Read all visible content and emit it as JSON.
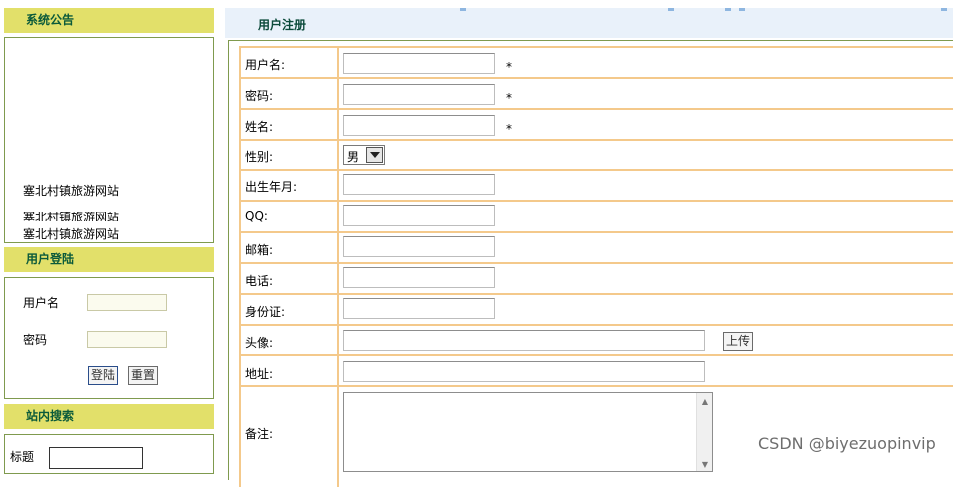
{
  "sidebar": {
    "notice": {
      "title": "系统公告",
      "items": [
        "塞北村镇旅游网站",
        "塞北村镇旅游网站",
        "塞北村镇旅游网站"
      ]
    },
    "login": {
      "title": "用户登陆",
      "username_label": "用户名",
      "password_label": "密码",
      "login_button": "登陆",
      "reset_button": "重置"
    },
    "search": {
      "title": "站内搜索",
      "title_label": "标题"
    }
  },
  "register": {
    "title": "用户注册",
    "required_mark": "*",
    "fields": {
      "username": "用户名:",
      "password": "密码:",
      "name": "姓名:",
      "gender": "性别:",
      "birth": "出生年月:",
      "qq": "QQ:",
      "email": "邮箱:",
      "phone": "电话:",
      "idcard": "身份证:",
      "avatar": "头像:",
      "address": "地址:",
      "remark": "备注:"
    },
    "gender_value": "男",
    "upload_button": "上传"
  },
  "watermark": "CSDN @biyezuopinvip",
  "colors": {
    "panel_header": "#e2e06a",
    "row_border": "#f4c98b",
    "panel_border": "#7f9a4e",
    "header_bar": "#e9f1fa"
  }
}
